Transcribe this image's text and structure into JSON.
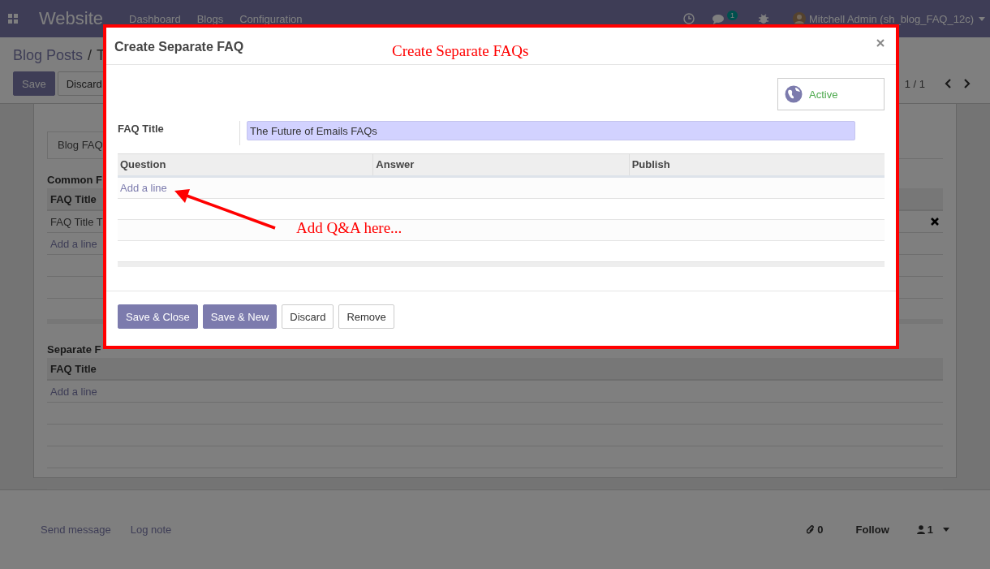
{
  "navbar": {
    "app": "Website",
    "menu": [
      "Dashboard",
      "Blogs",
      "Configuration"
    ],
    "messages_count": "1",
    "user": "Mitchell Admin (sh_blog_FAQ_12c)"
  },
  "breadcrumb": {
    "parent": "Blog Posts",
    "separator": "/",
    "current": "T"
  },
  "control_buttons": [
    {
      "label": "Save",
      "primary": true
    },
    {
      "label": "Discard",
      "primary": false
    }
  ],
  "pager": "1 / 1",
  "sheet": {
    "tab": "Blog FAQ",
    "sections": [
      {
        "title": "Common F",
        "column": "FAQ Title",
        "rows": [
          "FAQ Title T"
        ],
        "add_line": "Add a line"
      },
      {
        "title": "Separate F",
        "column": "FAQ Title",
        "add_line": "Add a line"
      }
    ]
  },
  "chatter": {
    "send_message": "Send message",
    "log_note": "Log note",
    "attachments": "0",
    "follow": "Follow",
    "followers": "1"
  },
  "dialog": {
    "title": "Create Separate FAQ",
    "active": {
      "label": "Active",
      "on": true
    },
    "field_label": "FAQ Title",
    "field_value": "The Future of Emails FAQs",
    "columns": [
      "Question",
      "Answer",
      "Publish"
    ],
    "add_line": "Add a line",
    "buttons": [
      {
        "label": "Save & Close",
        "primary": true
      },
      {
        "label": "Save & New",
        "primary": true
      },
      {
        "label": "Discard",
        "primary": false
      },
      {
        "label": "Remove",
        "primary": false
      }
    ]
  },
  "annotations": [
    {
      "text": "Create Separate FAQs"
    },
    {
      "text": "Add Q&A here..."
    }
  ]
}
